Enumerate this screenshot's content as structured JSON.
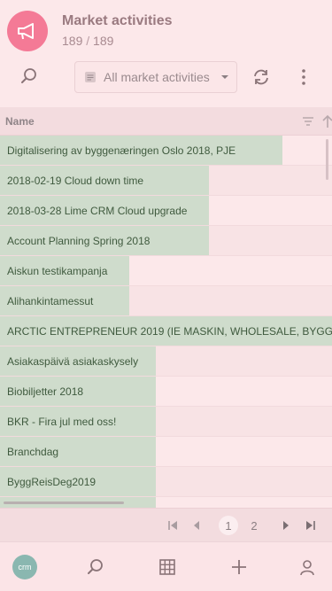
{
  "header": {
    "title": "Market activities",
    "count_shown": "189",
    "count_separator": "/",
    "count_total": "189",
    "filter_label": "All market activities"
  },
  "grid": {
    "column_name": "Name",
    "rows": [
      {
        "label": "Digitalisering av byggenæringen Oslo 2018, PJE",
        "bar": 0.85
      },
      {
        "label": "2018-02-19 Cloud down time",
        "bar": 0.63
      },
      {
        "label": "2018-03-28 Lime CRM Cloud upgrade",
        "bar": 0.63
      },
      {
        "label": "Account Planning Spring 2018",
        "bar": 0.63
      },
      {
        "label": "Aiskun testikampanja",
        "bar": 0.39
      },
      {
        "label": "Alihankintamessut",
        "bar": 0.39
      },
      {
        "label": "ARCTIC ENTREPRENEUR 2019 (IE MASKIN, WHOLESALE, BYGG",
        "bar": 1.0
      },
      {
        "label": "Asiakaspäivä asiakaskysely",
        "bar": 0.47
      },
      {
        "label": "Biobiljetter 2018",
        "bar": 0.47
      },
      {
        "label": "BKR - Fira jul med oss!",
        "bar": 0.47
      },
      {
        "label": "Branchdag",
        "bar": 0.47
      },
      {
        "label": "ByggReisDeg2019",
        "bar": 0.47
      },
      {
        "label": "",
        "bar": 0.47
      }
    ]
  },
  "pager": {
    "current_page": "1",
    "next_page": "2"
  },
  "nav": {
    "crm_label": "crm"
  },
  "colors": {
    "accent": "#f47a96",
    "row_fill": "#cfdccc",
    "background": "#fce8ea"
  }
}
